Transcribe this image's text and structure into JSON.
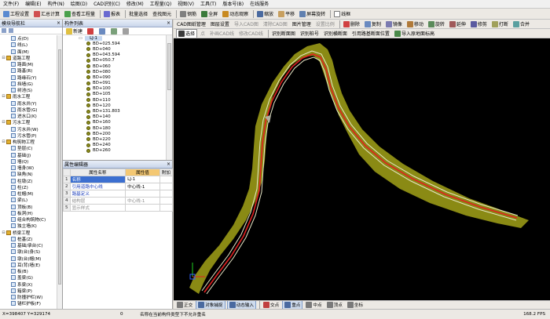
{
  "menu": [
    "文件(F)",
    "编辑(E)",
    "构件(N)",
    "绘图(D)",
    "CAD识别(C)",
    "修改(M)",
    "工程量(Q)",
    "视图(V)",
    "工具(T)",
    "版本号(B)",
    "在线服务"
  ],
  "toolbar1": {
    "project_settings": "工程设置",
    "calc_all": "汇总计算",
    "view_qty": "查看工程量",
    "report": "报表",
    "batch_select": "批量选择",
    "find_element": "查找图元",
    "rebar": "钢筋",
    "full_screen": "全屏",
    "dynamic_view": "动态观察",
    "zoom": "缩放",
    "pan": "平移",
    "screen_rotate": "屏幕旋转",
    "wireframe": "线框"
  },
  "toolbar2": {
    "cad_manage": "CAD图纸管理",
    "layer_settings": "图层设置",
    "import_cad": "导入CAD图",
    "clear_cad": "清除CAD图",
    "picture_manage": "图片管理",
    "set_scale": "设置比例",
    "delete": "删除",
    "copy": "复制",
    "mirror": "镜像",
    "move": "移动",
    "rotate": "旋转",
    "extend": "延伸",
    "trim": "修剪",
    "break": "打断",
    "merge": "合并"
  },
  "nav_panel": {
    "title": "模块导航栏",
    "close": "×",
    "items": [
      {
        "label": "点(D)",
        "type": "child"
      },
      {
        "label": "线(L)",
        "type": "child"
      },
      {
        "label": "面(M)",
        "type": "child"
      },
      {
        "label": "道路工程",
        "type": "group"
      },
      {
        "label": "路面(M)",
        "type": "child"
      },
      {
        "label": "路基(R)",
        "type": "child"
      },
      {
        "label": "路缘石(Y)",
        "type": "child"
      },
      {
        "label": "挡墙(G)",
        "type": "child"
      },
      {
        "label": "树池(S)",
        "type": "child"
      },
      {
        "label": "雨水工程",
        "type": "group"
      },
      {
        "label": "雨水井(Y)",
        "type": "child"
      },
      {
        "label": "雨水管(G)",
        "type": "child"
      },
      {
        "label": "进水口(K)",
        "type": "child"
      },
      {
        "label": "污水工程",
        "type": "group"
      },
      {
        "label": "污水井(W)",
        "type": "child"
      },
      {
        "label": "污水管(P)",
        "type": "child"
      },
      {
        "label": "构筑物工程",
        "type": "group"
      },
      {
        "label": "垫层(C)",
        "type": "child"
      },
      {
        "label": "基础(J)",
        "type": "child"
      },
      {
        "label": "墙(Q)",
        "type": "child"
      },
      {
        "label": "墙身(W)",
        "type": "child"
      },
      {
        "label": "缺角(N)",
        "type": "child"
      },
      {
        "label": "柱墩(Z)",
        "type": "child"
      },
      {
        "label": "柱(Z)",
        "type": "child"
      },
      {
        "label": "柱帽(M)",
        "type": "child"
      },
      {
        "label": "梁(L)",
        "type": "child"
      },
      {
        "label": "顶板(B)",
        "type": "child"
      },
      {
        "label": "板洞(H)",
        "type": "child"
      },
      {
        "label": "组合构筑物(C)",
        "type": "child"
      },
      {
        "label": "独立墙(K)",
        "type": "child"
      },
      {
        "label": "桥梁工程",
        "type": "group"
      },
      {
        "label": "桩基(Z)",
        "type": "child"
      },
      {
        "label": "基础/承台(C)",
        "type": "child"
      },
      {
        "label": "墩(台)身(S)",
        "type": "child"
      },
      {
        "label": "墩(台)帽(M)",
        "type": "child"
      },
      {
        "label": "耳(背)墙(E)",
        "type": "child"
      },
      {
        "label": "板(B)",
        "type": "child"
      },
      {
        "label": "盖梁(G)",
        "type": "child"
      },
      {
        "label": "系梁(X)",
        "type": "child"
      },
      {
        "label": "箱梁(P)",
        "type": "child"
      },
      {
        "label": "防撞护栏(W)",
        "type": "child"
      },
      {
        "label": "锚栏护板(F)",
        "type": "child"
      }
    ]
  },
  "component_list": {
    "title": "构件列表",
    "close": "×",
    "new_label": "新建",
    "root": "LJ-1",
    "items": [
      "BD+025.594",
      "BD+040",
      "BD+043.594",
      "BD+050.7",
      "BD+060",
      "BD+080",
      "BD+090",
      "BD+091",
      "BD+100",
      "BD+105",
      "BD+110",
      "BD+120",
      "BD+131.803",
      "BD+140",
      "BD+160",
      "BD+180",
      "BD+200",
      "BD+220",
      "BD+240",
      "BD+260"
    ]
  },
  "properties": {
    "title": "属性编辑器",
    "close": "×",
    "col_name": "属性名称",
    "col_value": "属性值",
    "col_extra": "附加",
    "rows": [
      {
        "num": "1",
        "name": "名称",
        "value": "LJ-1",
        "style": "hl"
      },
      {
        "num": "2",
        "name": "引用道路中心线",
        "value": "中心线-1",
        "style": "blue"
      },
      {
        "num": "3",
        "name": "路基定义",
        "value": "",
        "style": "blue"
      },
      {
        "num": "4",
        "name": "结构层",
        "value": "中心线-1",
        "style": "grey"
      },
      {
        "num": "5",
        "name": "显示样式",
        "value": "",
        "style": "grey"
      }
    ]
  },
  "canvas_bar1": {
    "select": "选择",
    "point": "点",
    "extract_cad": "补画CAD线",
    "modify_cad": "修改CAD线",
    "recognize_sections": "识别断面图",
    "recognize_piles": "识别桩号",
    "recognize_cross": "识别横断面",
    "ref_road": "引用路基断面位置",
    "import_station": "导入原地面标高"
  },
  "snap_bar": {
    "ortho": "正交",
    "object_snap": "对象捕捉",
    "dynamic_input": "动态输入",
    "intersection": "交点",
    "midpoint_toggle": "重点",
    "midpoint": "中点",
    "vertex": "顶点",
    "coordinate": "坐标"
  },
  "status": {
    "coords": "X=398407 Y=329174",
    "layer": "0",
    "message": "名称在当前构件类型下不允许重名",
    "fps": "168.2 FPS"
  },
  "colors": {
    "roadbed": "#8a8a14",
    "centerline": "#e02020",
    "road_edge": "#e8e8c8",
    "canvas_bg": "#000000"
  }
}
